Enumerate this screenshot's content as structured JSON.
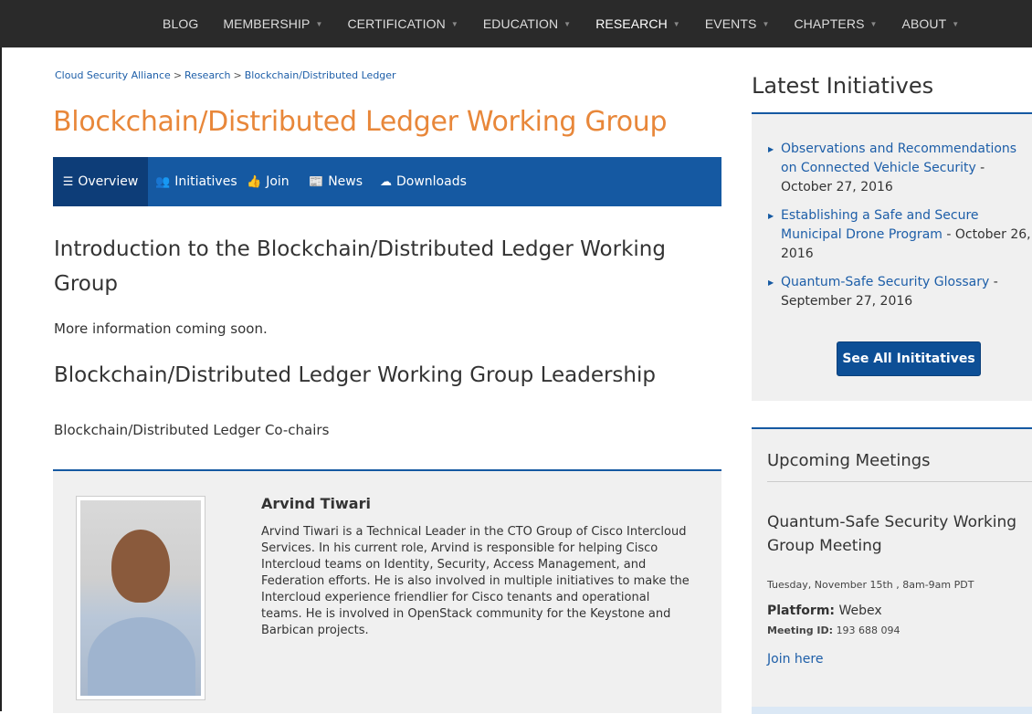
{
  "topnav": {
    "items": [
      {
        "label": "BLOG",
        "caret": ""
      },
      {
        "label": "MEMBERSHIP",
        "caret": "▼"
      },
      {
        "label": "CERTIFICATION",
        "caret": "▼"
      },
      {
        "label": "EDUCATION",
        "caret": "▼"
      },
      {
        "label": "RESEARCH",
        "caret": "▼"
      },
      {
        "label": "EVENTS",
        "caret": "▼"
      },
      {
        "label": "CHAPTERS",
        "caret": "▼"
      },
      {
        "label": "ABOUT",
        "caret": "▼"
      }
    ]
  },
  "breadcrumb": {
    "items": [
      "Cloud Security Alliance",
      "Research",
      "Blockchain/Distributed Ledger"
    ],
    "separator": ">"
  },
  "page_title": "Blockchain/Distributed Ledger Working Group",
  "subnav": {
    "overview": "Overview",
    "initiatives": "Initiatives",
    "join": "Join",
    "news": "News",
    "downloads": "Downloads"
  },
  "content": {
    "intro_heading": "Introduction to the Blockchain/Distributed Ledger Working Group",
    "intro_text": "More information coming soon.",
    "leadership_heading": "Blockchain/Distributed Ledger Working Group Leadership",
    "cochairs_label": "Blockchain/Distributed Ledger Co-chairs",
    "member": {
      "name": "Arvind Tiwari",
      "bio": "Arvind Tiwari is a Technical Leader in the CTO Group of Cisco Intercloud Services. In his current role, Arvind is responsible for helping Cisco Intercloud teams on Identity, Security, Access Management, and Federation efforts. He is also involved in multiple initiatives to make the Intercloud experience friendlier for Cisco tenants and operational teams. He is involved in OpenStack community for the Keystone and Barbican projects."
    }
  },
  "sidebar": {
    "latest_title": "Latest Initiatives",
    "initiatives": [
      {
        "title": "Observations and Recommendations on Connected Vehicle Security",
        "date": "October 27, 2016"
      },
      {
        "title": "Establishing a Safe and Secure Municipal Drone Program",
        "date": "October 26, 2016"
      },
      {
        "title": "Quantum-Safe Security Glossary",
        "date": "September 27, 2016"
      }
    ],
    "see_all_label": "See All Inititatives",
    "meetings": {
      "title": "Upcoming Meetings",
      "meeting_name": "Quantum-Safe Security Working Group Meeting",
      "date_time": "Tuesday, November 15th , 8am-9am PDT",
      "platform_label": "Platform:",
      "platform_value": "Webex",
      "meeting_id_label": "Meeting ID:",
      "meeting_id_value": "193 688 094",
      "join_label": "Join here"
    }
  },
  "colors": {
    "title_orange": "#e8873a",
    "nav_blue": "#1559a2",
    "link_blue": "#1d5ea8",
    "topbar": "#2a2a2a"
  }
}
